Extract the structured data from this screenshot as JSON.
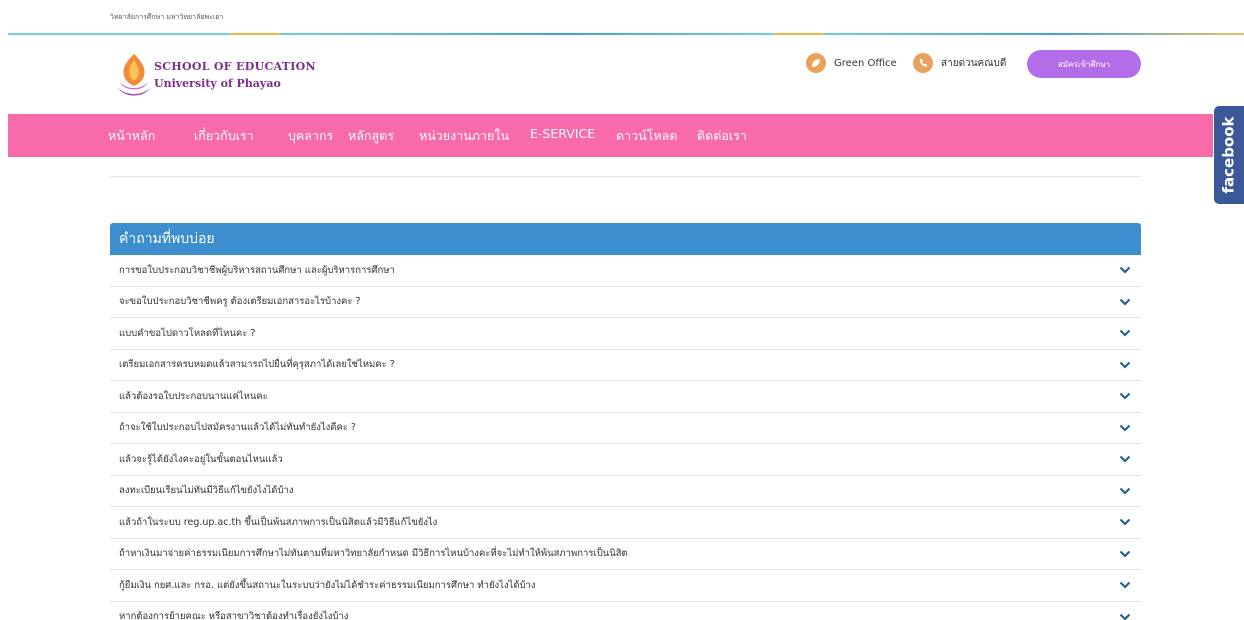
{
  "topbar": {
    "text": "วิทยาลัยการศึกษา มหาวิทยาลัยพะเยา"
  },
  "logo": {
    "line1": "SCHOOL OF EDUCATION",
    "line2": "University of Phayao"
  },
  "header": {
    "green_office": "Green Office",
    "hotline": "สายด่วนคณบดี",
    "apply_button": "สมัครเข้าศึกษา"
  },
  "nav": {
    "items": [
      "หน้าหลัก",
      "เกี่ยวกับเรา",
      "บุคลากร",
      "หลักสูตร",
      "หน่วยงานภายใน",
      "E-SERVICE",
      "ดาวน์โหลด",
      "ติดต่อเรา"
    ]
  },
  "facebook": {
    "label": "facebook"
  },
  "faq": {
    "title": "คำถามที่พบบ่อย",
    "questions": [
      "การขอใบประกอบวิชาชีพผู้บริหารสถานศึกษา และผู้บริหารการศึกษา",
      "จะขอใบประกอบวิชาชีพครู ต้องเตรียมเอกสารอะไรบ้างคะ ?",
      "แบบคำขอไปดาวโหลดที่ไหนคะ ?",
      "เตรียมเอกสารครบหมดแล้วสามารถไปยื่นที่คุรุสภาได้เลยใช่ไหมคะ ?",
      "แล้วต้องรอใบประกอบนานแค่ไหนคะ",
      "ถ้าจะใช้ใบประกอบไปสมัครงานแล้วได้ไม่ทันทำยังไงดีคะ ?",
      "แล้วจะรู้ได้ยังไงคะอยู่ในขั้นตอนไหนแล้ว",
      "ลงทะเบียนเรียนไม่ทันมีวิธีแก้ไขยังไงได้บ้าง",
      "แล้วถ้าในระบบ reg.up.ac.th ขึ้นเป็นพ้นสภาพการเป็นนิสิตแล้วมีวิธีแก้ไขยังไง",
      "ถ้าหาเงินมาจ่ายค่าธรรมเนียมการศึกษาไม่ทันตามที่มหาวิทยาลัยกำหนด มีวิธีการไหนบ้างคะที่จะไม่ทำให้พ้นสภาพการเป็นนิสิต",
      "กู้ยืมเงิน กยศ.และ กรอ. แต่ยังขึ้นสถานะในระบบว่ายังไม่ได้ชำระค่าธรรมเนียมการศึกษา ทำยังไงได้บ้าง",
      "หากต้องการย้ายคณะ หรือสาขาวิชาต้องทำเรื่องยังไงบ้าง"
    ]
  }
}
